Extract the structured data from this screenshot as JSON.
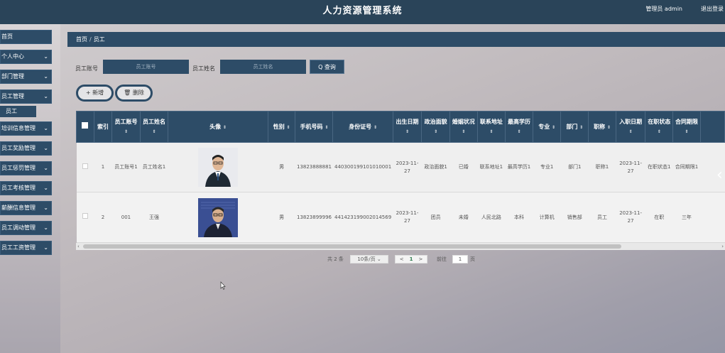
{
  "app": {
    "title": "人力资源管理系统",
    "user": "管理员 admin",
    "logout": "退出登录"
  },
  "sidebar": {
    "items": [
      {
        "label": "首页",
        "chevron": false
      },
      {
        "label": "个人中心",
        "chevron": true
      },
      {
        "label": "部门管理",
        "chevron": true
      },
      {
        "label": "员工管理",
        "chevron": true
      },
      {
        "label": "培训信息管理",
        "chevron": true
      },
      {
        "label": "员工奖励管理",
        "chevron": true
      },
      {
        "label": "员工惩罚管理",
        "chevron": true
      },
      {
        "label": "员工考核管理",
        "chevron": true
      },
      {
        "label": "薪酬信息管理",
        "chevron": true
      },
      {
        "label": "员工调动管理",
        "chevron": true
      },
      {
        "label": "员工工资管理",
        "chevron": true
      }
    ],
    "sub_item": "员工",
    "chevron_glyph": "⌄"
  },
  "breadcrumb": {
    "home": "首页",
    "sep": "/",
    "current": "员工"
  },
  "search": {
    "emp_no_label": "员工账号",
    "emp_no_placeholder": "员工账号",
    "emp_name_label": "员工姓名",
    "emp_name_placeholder": "员工姓名",
    "query_button": "Q 查询"
  },
  "actions": {
    "add": "+ 新增",
    "delete": "🗑 删除"
  },
  "table": {
    "headers": [
      "",
      "索引",
      "员工账号",
      "员工姓名",
      "头像",
      "性别",
      "手机号码",
      "身份证号",
      "出生日期",
      "政治面貌",
      "婚姻状况",
      "联系地址",
      "最高学历",
      "专业",
      "部门",
      "职称",
      "入职日期",
      "在职状态",
      "合同期限"
    ],
    "sortable": [
      false,
      false,
      true,
      true,
      true,
      true,
      true,
      true,
      true,
      true,
      true,
      true,
      true,
      true,
      true,
      true,
      true,
      true,
      true
    ],
    "sort_glyph": "⇕",
    "rows": [
      [
        "",
        "1",
        "员工账号1",
        "员工姓名1",
        "",
        "男",
        "13823888881",
        "440300199101010001",
        "2023-11-27",
        "政治面貌1",
        "已婚",
        "联系地址1",
        "最高学历1",
        "专业1",
        "部门1",
        "职称1",
        "2023-11-27",
        "在职状态1",
        "合同期限1"
      ],
      [
        "",
        "2",
        "001",
        "王强",
        "",
        "男",
        "13823899996",
        "441423199002014569",
        "2023-11-27",
        "团员",
        "未婚",
        "人民北路",
        "本科",
        "计算机",
        "销售部",
        "员工",
        "2023-11-27",
        "在职",
        "三年"
      ]
    ]
  },
  "pager": {
    "total": "共 2 条",
    "page_size": "10条/页",
    "prev": "<",
    "current": "1",
    "next": ">",
    "goto_label": "前往",
    "goto_value": "1",
    "page_suffix": "页"
  },
  "colors": {
    "primary": "#2d4c67",
    "topbar": "#2a4459"
  }
}
